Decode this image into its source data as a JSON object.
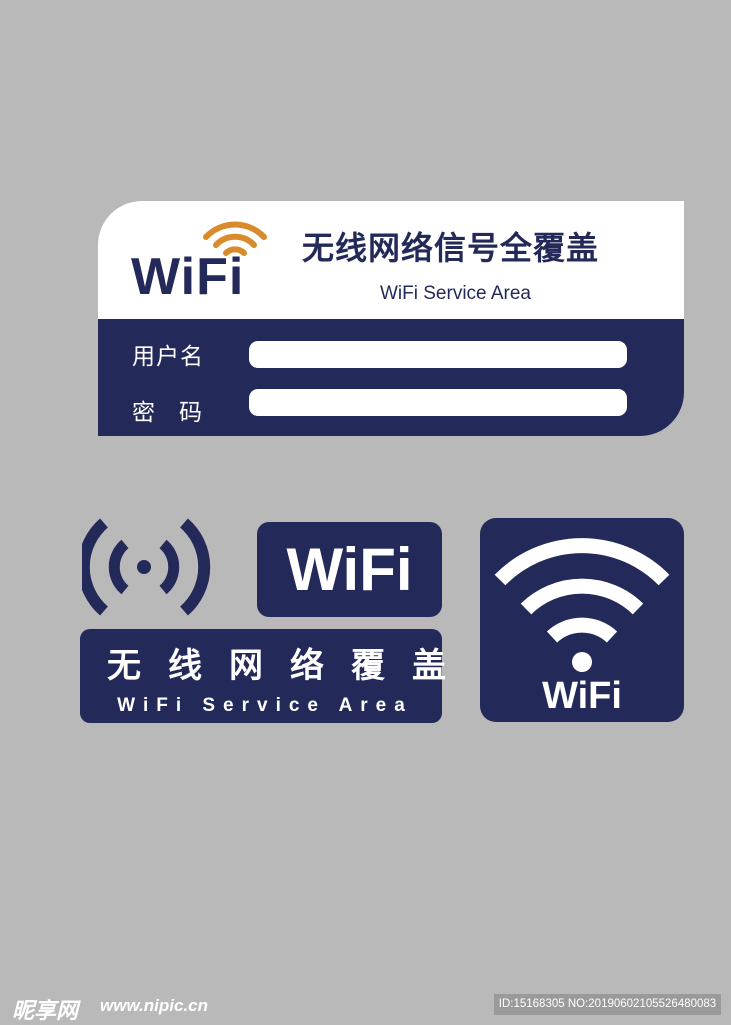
{
  "colors": {
    "background": "#b9b9b9",
    "navy": "#232a5a",
    "orange": "#d98a2b",
    "white": "#ffffff"
  },
  "card": {
    "logo_text": "WiFi",
    "logo_icon": "wifi-signal-icon",
    "title": "无线网络信号全覆盖",
    "subtitle": "WiFi Service Area",
    "username_label": "用户名",
    "password_label": "密码",
    "username_value": "",
    "password_value": ""
  },
  "broadcast": {
    "icon": "broadcast-icon"
  },
  "badge": {
    "text": "WiFi"
  },
  "banner": {
    "title": "无线网络覆盖",
    "subtitle": "WiFi Service Area"
  },
  "square": {
    "icon": "wifi-icon",
    "text": "WiFi"
  },
  "watermark": {
    "logo": "昵享网",
    "url": "www.nipic.cn",
    "id_text": "ID:15168305 NO:20190602105526480083"
  }
}
